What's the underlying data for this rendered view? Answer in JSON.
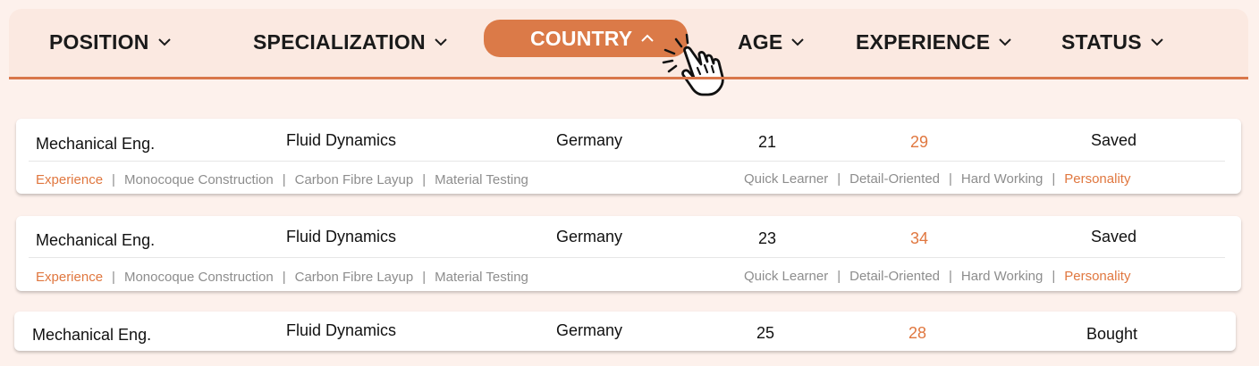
{
  "filters": [
    {
      "label": "POSITION",
      "active": false
    },
    {
      "label": "SPECIALIZATION",
      "active": false
    },
    {
      "label": "COUNTRY",
      "active": true
    },
    {
      "label": "AGE",
      "active": false
    },
    {
      "label": "EXPERIENCE",
      "active": false
    },
    {
      "label": "STATUS",
      "active": false
    }
  ],
  "colors": {
    "accent": "#db7a48",
    "background": "#fdf1ec",
    "header_bg": "#fbe9e1"
  },
  "rows": [
    {
      "position": "Mechanical Eng.",
      "specialization": "Fluid Dynamics",
      "country": "Germany",
      "age": "21",
      "experience": "29",
      "status": "Saved",
      "skills_label": "Experience",
      "skills": [
        "Monocoque Construction",
        "Carbon Fibre Layup",
        "Material Testing"
      ],
      "traits": [
        "Quick Learner",
        "Detail-Oriented",
        "Hard Working"
      ],
      "traits_label": "Personality"
    },
    {
      "position": "Mechanical Eng.",
      "specialization": "Fluid Dynamics",
      "country": "Germany",
      "age": "23",
      "experience": "34",
      "status": "Saved",
      "skills_label": "Experience",
      "skills": [
        "Monocoque Construction",
        "Carbon Fibre Layup",
        "Material Testing"
      ],
      "traits": [
        "Quick Learner",
        "Detail-Oriented",
        "Hard Working"
      ],
      "traits_label": "Personality"
    },
    {
      "position": "Mechanical Eng.",
      "specialization": "Fluid Dynamics",
      "country": "Germany",
      "age": "25",
      "experience": "28",
      "status": "Bought"
    }
  ],
  "icons": {
    "chevron_down": "chevron-down-icon",
    "chevron_up": "chevron-up-icon",
    "pointer": "hand-pointer-click-icon"
  },
  "separator": "|"
}
